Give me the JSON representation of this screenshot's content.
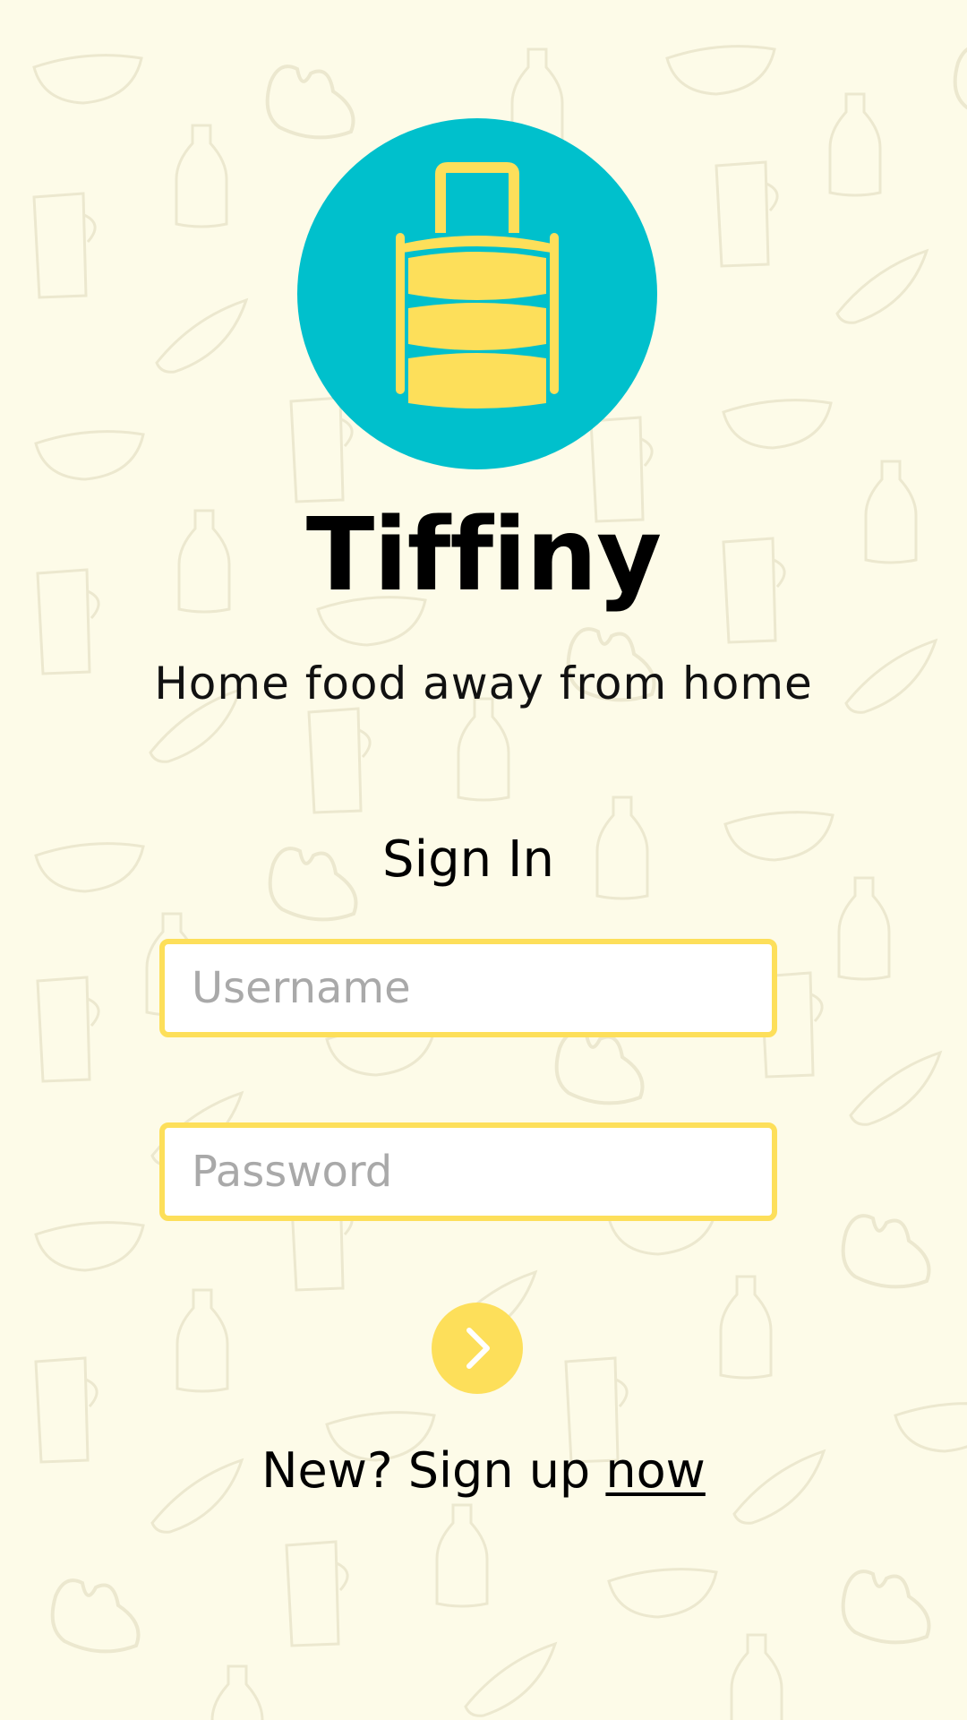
{
  "app": {
    "title": "Tiffiny",
    "tagline": "Home food away from home"
  },
  "signin": {
    "heading": "Sign In",
    "username_placeholder": "Username",
    "username_value": "",
    "password_placeholder": "Password",
    "password_value": "",
    "submit_icon": "chevron-right-icon"
  },
  "signup": {
    "prompt": "New? Sign up ",
    "link_label": "now"
  },
  "icons": {
    "logo": "tiffin-box-icon"
  },
  "colors": {
    "background": "#fdfbe8",
    "accent_yellow": "#fddf5a",
    "logo_circle": "#00c0cc",
    "pattern_stroke": "#ece8cf",
    "text": "#000000",
    "placeholder": "#a9a9a9"
  }
}
